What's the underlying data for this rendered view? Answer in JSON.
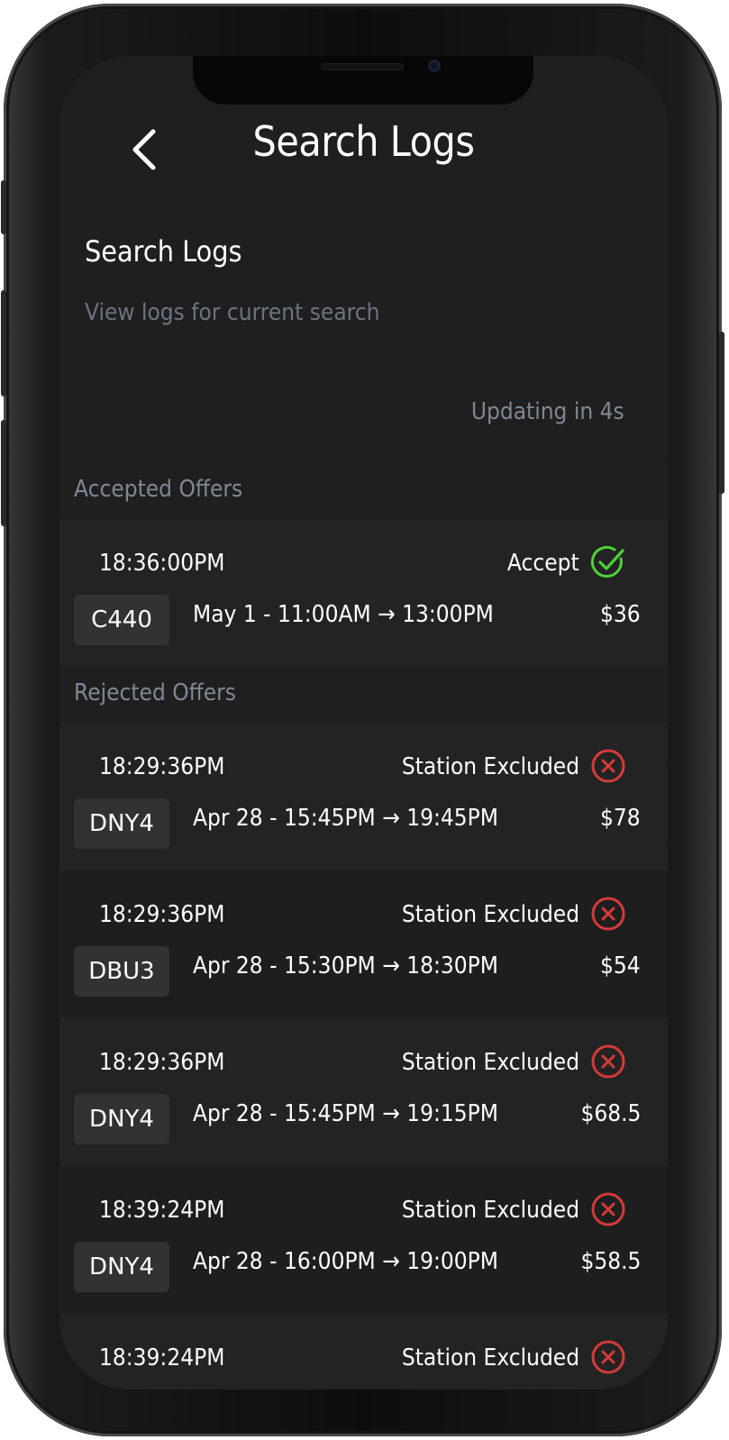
{
  "header": {
    "title": "Search Logs",
    "back_icon": "chevron-left-icon"
  },
  "section": {
    "title": "Search Logs",
    "subtitle": "View logs for current search"
  },
  "updating_text": "Updating in 4s",
  "accepted": {
    "label": "Accepted Offers",
    "offers": [
      {
        "time": "18:36:00PM",
        "status": "Accept",
        "status_icon": "check-circle-icon",
        "station": "C440",
        "window": "May 1 - 11:00AM → 13:00PM",
        "price": "$36"
      }
    ]
  },
  "rejected": {
    "label": "Rejected Offers",
    "offers": [
      {
        "time": "18:29:36PM",
        "status": "Station Excluded",
        "status_icon": "x-circle-icon",
        "station": "DNY4",
        "window": "Apr 28 - 15:45PM → 19:45PM",
        "price": "$78"
      },
      {
        "time": "18:29:36PM",
        "status": "Station Excluded",
        "status_icon": "x-circle-icon",
        "station": "DBU3",
        "window": "Apr 28 - 15:30PM → 18:30PM",
        "price": "$54"
      },
      {
        "time": "18:29:36PM",
        "status": "Station Excluded",
        "status_icon": "x-circle-icon",
        "station": "DNY4",
        "window": "Apr 28 - 15:45PM → 19:15PM",
        "price": "$68.5"
      },
      {
        "time": "18:39:24PM",
        "status": "Station Excluded",
        "status_icon": "x-circle-icon",
        "station": "DNY4",
        "window": "Apr 28 - 16:00PM → 19:00PM",
        "price": "$58.5"
      },
      {
        "time": "18:39:24PM",
        "status": "Station Excluded",
        "status_icon": "x-circle-icon",
        "station": "",
        "window": "",
        "price": ""
      }
    ]
  },
  "colors": {
    "background": "#1f1f20",
    "accept": "#4cd137",
    "reject": "#d63a3a",
    "muted_text": "#7f8894"
  }
}
